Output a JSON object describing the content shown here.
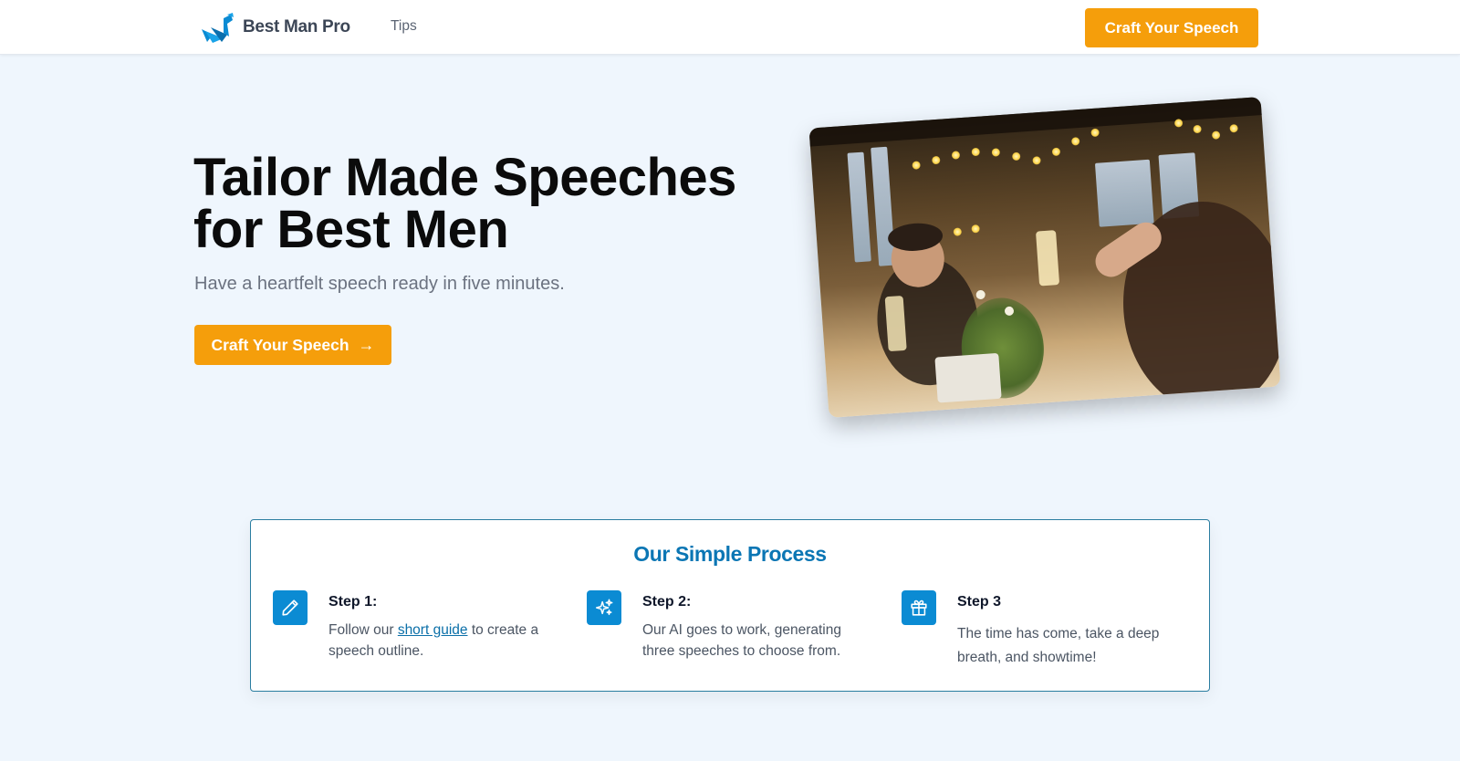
{
  "header": {
    "logo_text": "Best Man Pro",
    "nav_tips": "Tips",
    "cta_label": "Craft Your Speech"
  },
  "hero": {
    "title_line1": "Tailor Made Speeches",
    "title_line2": "for Best Men",
    "subtitle": "Have a heartfelt speech ready in five minutes.",
    "cta_label": "Craft Your Speech",
    "cta_arrow": "→"
  },
  "process": {
    "title": "Our Simple Process",
    "steps": [
      {
        "icon": "pencil-icon",
        "heading": "Step 1:",
        "text_before": "Follow our ",
        "link_text": "short guide",
        "text_after": " to create a speech outline."
      },
      {
        "icon": "sparkles-icon",
        "heading": "Step 2:",
        "text": "Our AI goes to work, generating three speeches to choose from."
      },
      {
        "icon": "gift-icon",
        "heading": "Step 3",
        "text": "The time has come, take a deep breath, and showtime!"
      }
    ]
  },
  "colors": {
    "accent": "#f59e0b",
    "brand_blue": "#0b8bd3",
    "page_bg": "#eff6fd"
  }
}
